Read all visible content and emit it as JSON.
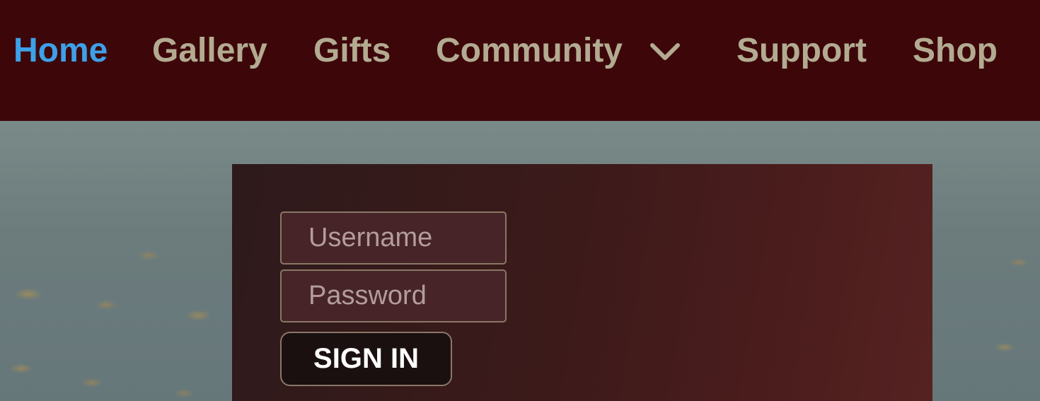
{
  "nav": {
    "items": [
      {
        "label": "Home",
        "active": true
      },
      {
        "label": "Gallery"
      },
      {
        "label": "Gifts"
      },
      {
        "label": "Community",
        "has_dropdown": true
      },
      {
        "label": "Support"
      },
      {
        "label": "Shop"
      }
    ],
    "dropdown_icon": "chevron-down-icon",
    "active_color": "#3da1e8",
    "item_color": "#b3ab91",
    "background_color": "#3d070a"
  },
  "login": {
    "username_placeholder": "Username",
    "password_placeholder": "Password",
    "signin_label": "SIGN IN"
  }
}
